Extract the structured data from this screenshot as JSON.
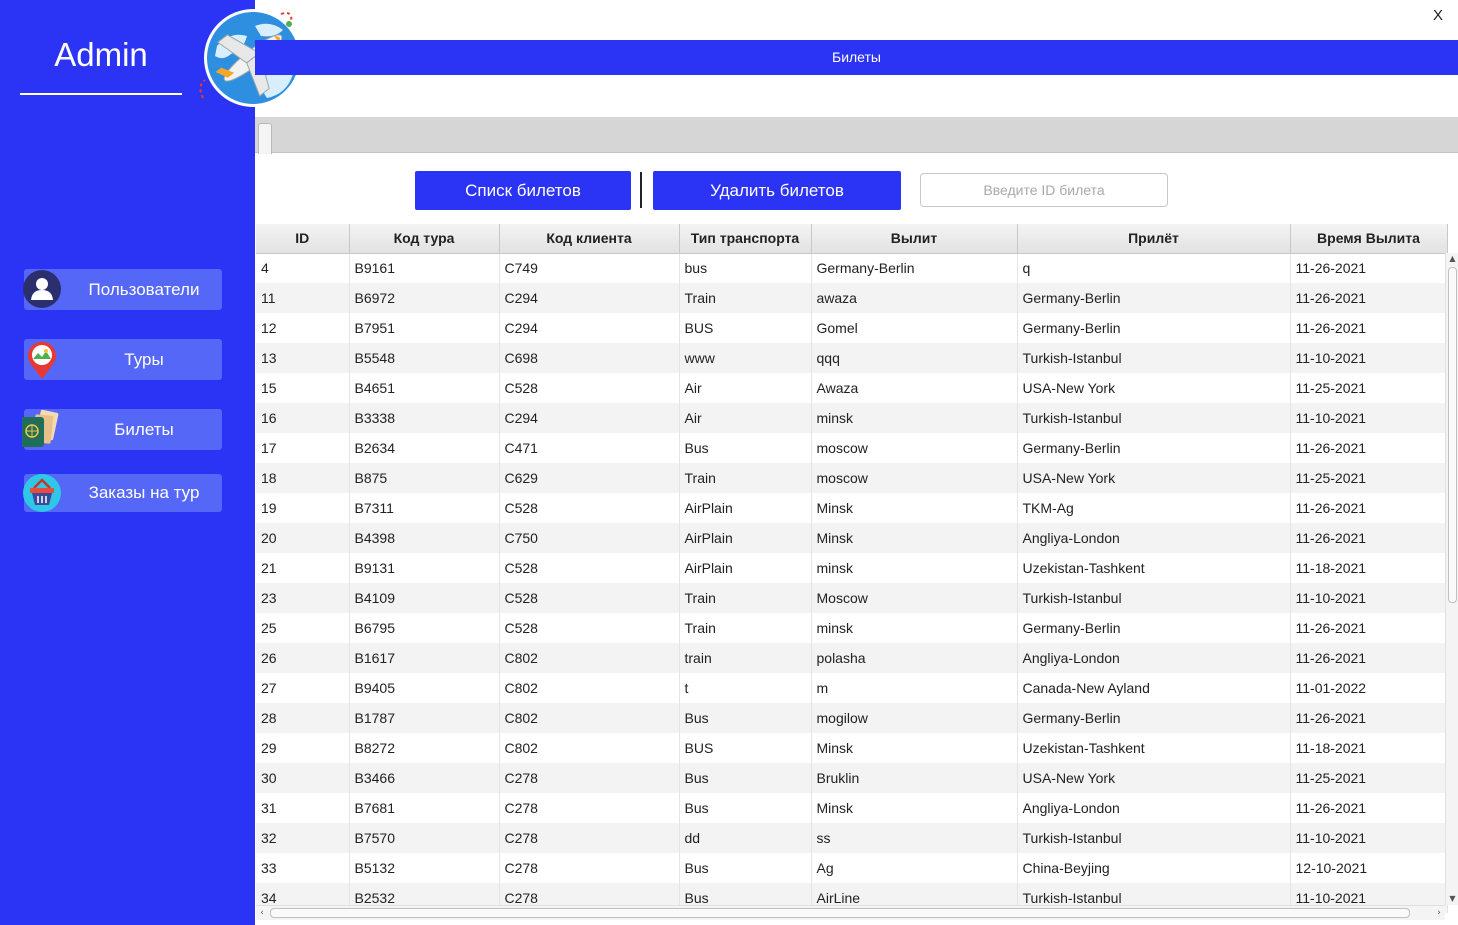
{
  "sidebar": {
    "title": "Admin",
    "items": [
      {
        "label": "Пользователи",
        "icon": "user-icon"
      },
      {
        "label": "Туры",
        "icon": "map-pin-icon"
      },
      {
        "label": "Билеты",
        "icon": "passport-tickets-icon"
      },
      {
        "label": "Заказы на тур",
        "icon": "basket-icon"
      }
    ]
  },
  "window": {
    "close_label": "X"
  },
  "header": {
    "title": "Билеты"
  },
  "toolbar": {
    "list_label": "Списк билетов",
    "delete_label": "Удалить билетов",
    "id_placeholder": "Введите ID билета"
  },
  "colors": {
    "accent": "#2b33f5",
    "nav_button": "#5567f7"
  },
  "table": {
    "columns": [
      "ID",
      "Код тура",
      "Код клиента",
      "Тип транспорта",
      "Вылит",
      "Прилёт",
      "Время Вылита"
    ],
    "rows": [
      [
        "4",
        "B9161",
        "C749",
        "bus",
        "Germany-Berlin",
        "q",
        "11-26-2021"
      ],
      [
        "11",
        "B6972",
        "C294",
        "Train",
        "awaza",
        "Germany-Berlin",
        "11-26-2021"
      ],
      [
        "12",
        "B7951",
        "C294",
        "BUS",
        "Gomel",
        "Germany-Berlin",
        "11-26-2021"
      ],
      [
        "13",
        "B5548",
        "C698",
        "www",
        "qqq",
        "Turkish-Istanbul",
        "11-10-2021"
      ],
      [
        "15",
        "B4651",
        "C528",
        "Air",
        "Awaza",
        "USA-New York",
        "11-25-2021"
      ],
      [
        "16",
        "B3338",
        "C294",
        "Air",
        "minsk",
        "Turkish-Istanbul",
        "11-10-2021"
      ],
      [
        "17",
        "B2634",
        "C471",
        "Bus",
        "moscow",
        "Germany-Berlin",
        "11-26-2021"
      ],
      [
        "18",
        "B875",
        "C629",
        "Train",
        "moscow",
        "USA-New York",
        "11-25-2021"
      ],
      [
        "19",
        "B7311",
        "C528",
        "AirPlain",
        "Minsk",
        "TKM-Ag",
        "11-26-2021"
      ],
      [
        "20",
        "B4398",
        "C750",
        "AirPlain",
        "Minsk",
        "Angliya-London",
        "11-26-2021"
      ],
      [
        "21",
        "B9131",
        "C528",
        "AirPlain",
        "minsk",
        "Uzekistan-Tashkent",
        "11-18-2021"
      ],
      [
        "23",
        "B4109",
        "C528",
        "Train",
        "Moscow",
        "Turkish-Istanbul",
        "11-10-2021"
      ],
      [
        "25",
        "B6795",
        "C528",
        "Train",
        "minsk",
        "Germany-Berlin",
        "11-26-2021"
      ],
      [
        "26",
        "B1617",
        "C802",
        "train",
        "polasha",
        "Angliya-London",
        "11-26-2021"
      ],
      [
        "27",
        "B9405",
        "C802",
        "t",
        "m",
        "Canada-New Ayland",
        "11-01-2022"
      ],
      [
        "28",
        "B1787",
        "C802",
        "Bus",
        "mogilow",
        "Germany-Berlin",
        "11-26-2021"
      ],
      [
        "29",
        "B8272",
        "C802",
        "BUS",
        "Minsk",
        "Uzekistan-Tashkent",
        "11-18-2021"
      ],
      [
        "30",
        "B3466",
        "C278",
        "Bus",
        "Bruklin",
        "USA-New York",
        "11-25-2021"
      ],
      [
        "31",
        "B7681",
        "C278",
        "Bus",
        "Minsk",
        "Angliya-London",
        "11-26-2021"
      ],
      [
        "32",
        "B7570",
        "C278",
        "dd",
        "ss",
        "Turkish-Istanbul",
        "11-10-2021"
      ],
      [
        "33",
        "B5132",
        "C278",
        "Bus",
        "Ag",
        "China-Beyjing",
        "12-10-2021"
      ],
      [
        "34",
        "B2532",
        "C278",
        "Bus",
        "AirLine",
        "Turkish-Istanbul",
        "11-10-2021"
      ]
    ]
  }
}
